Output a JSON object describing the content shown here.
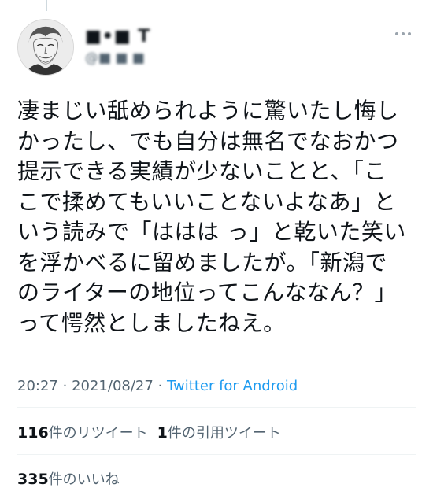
{
  "author": {
    "display_name": "■•■ T",
    "handle": "@■ ■ ■"
  },
  "tweet": {
    "text": "凄まじい舐められように驚いたし悔し\nかったし、でも自分は無名でなおかつ\n提示できる実績が少ないことと、「こ\nこで揉めてもいいことないよなあ」と\nいう読みで「ははは っ」と乾いた笑い\nを浮かべるに留めましたが。「新潟で\nのライターの地位ってこんななん？」\nって愕然としましたねえ。",
    "time": "20:27",
    "separator": "·",
    "date": "2021/08/27",
    "source": "Twitter for Android"
  },
  "stats": {
    "retweets_count": "116",
    "retweets_label": "件のリツイート",
    "quotes_count": "1",
    "quotes_label": "件の引用ツイート",
    "likes_count": "335",
    "likes_label": "件のいいね"
  },
  "colors": {
    "link": "#1d9bf0",
    "secondary_text": "#536471",
    "primary_text": "#0f1419",
    "divider": "#eff3f4"
  },
  "icons": {
    "more": "more-options-icon"
  }
}
